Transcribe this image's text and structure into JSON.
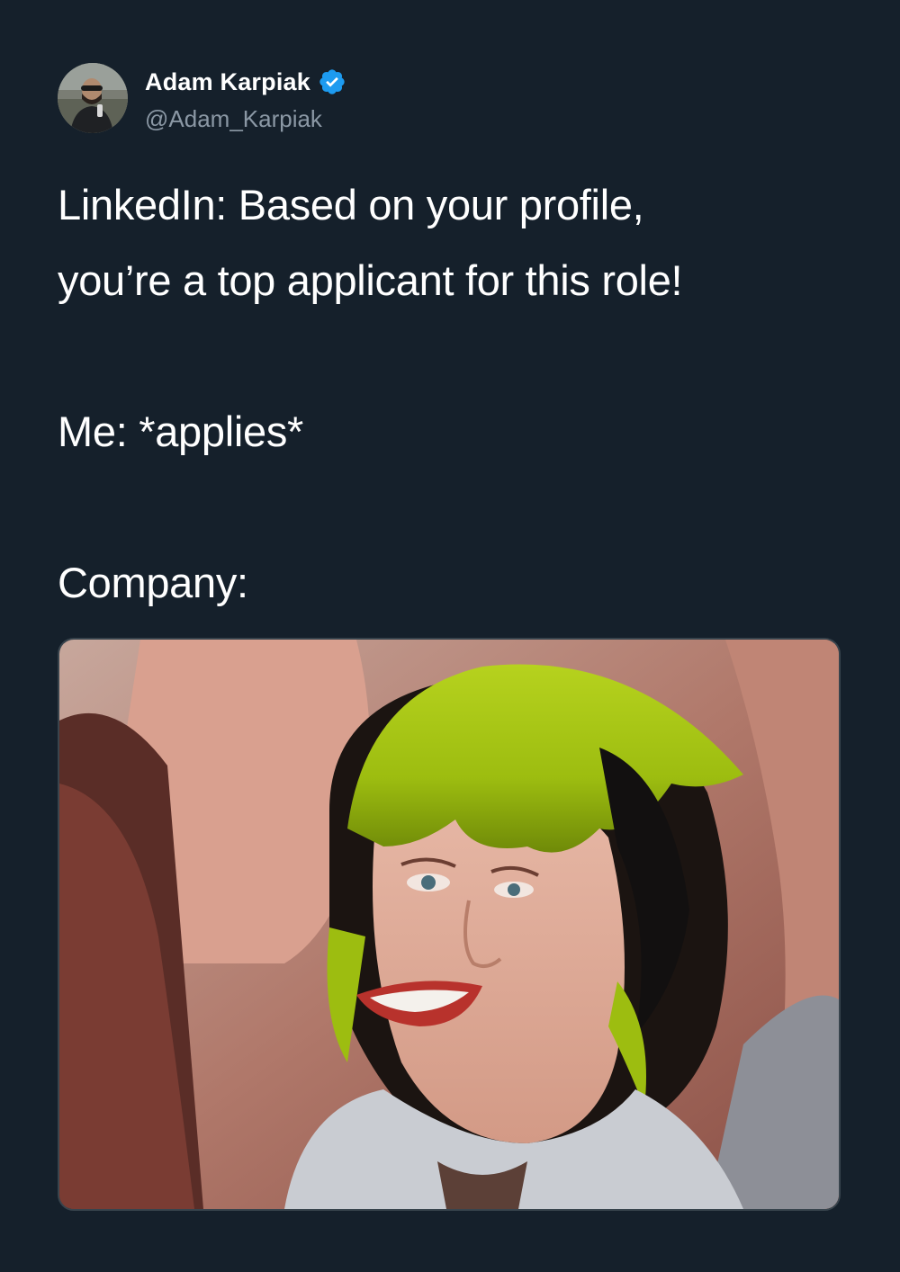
{
  "tweet": {
    "author": {
      "display_name": "Adam Karpiak",
      "handle": "@Adam_Karpiak",
      "verified": true,
      "avatar_icon": "profile-photo"
    },
    "text_lines": [
      "LinkedIn: Based on your profile,",
      "you’re a top applicant for this role!",
      "",
      "Me: *applies*",
      "",
      "Company:"
    ],
    "media": {
      "type": "image",
      "icon": "reaction-photo"
    }
  },
  "colors": {
    "background": "#15202b",
    "text": "#ffffff",
    "secondary_text": "#8b98a5",
    "verified_badge": "#1d9bf0",
    "media_border": "#38444d"
  }
}
